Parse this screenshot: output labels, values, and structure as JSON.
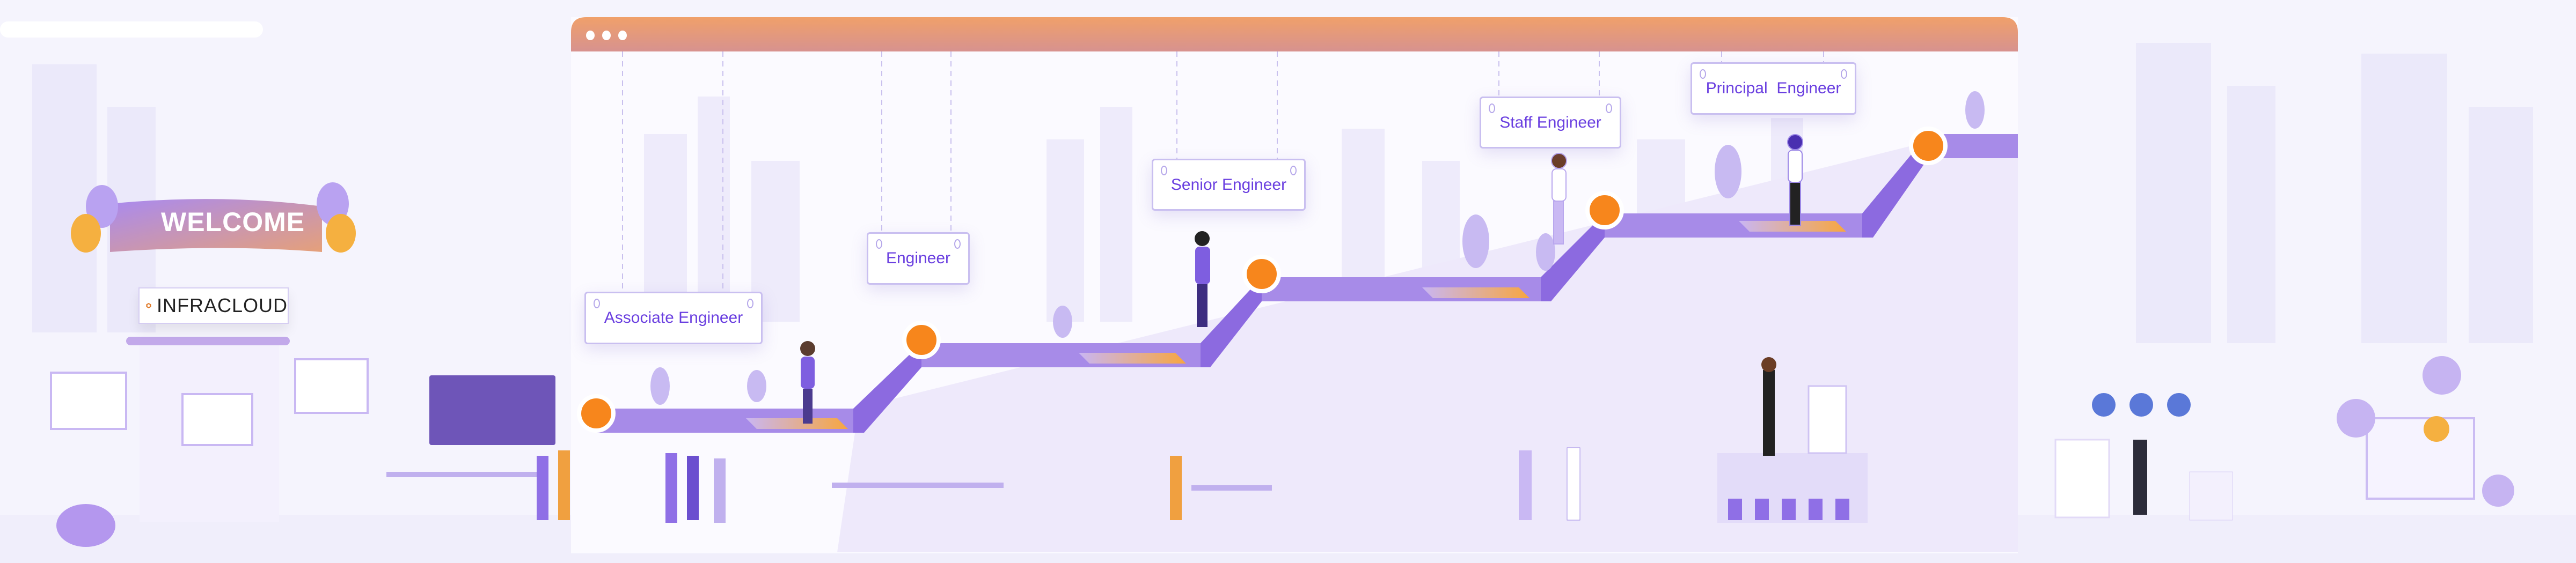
{
  "banner": {
    "text": "WELCOME"
  },
  "logo": {
    "text": "INFRACLOUD"
  },
  "career_ladder": {
    "levels": [
      {
        "label": "Associate Engineer"
      },
      {
        "label": "Engineer"
      },
      {
        "label": "Senior Engineer"
      },
      {
        "label": "Staff Engineer"
      },
      {
        "label": "Principal  Engineer"
      }
    ]
  },
  "colors": {
    "accent_purple": "#8f6fe6",
    "step_orange": "#f7861c",
    "titlebar_orange": "#f0a06a",
    "label_text": "#6a3fe0"
  }
}
